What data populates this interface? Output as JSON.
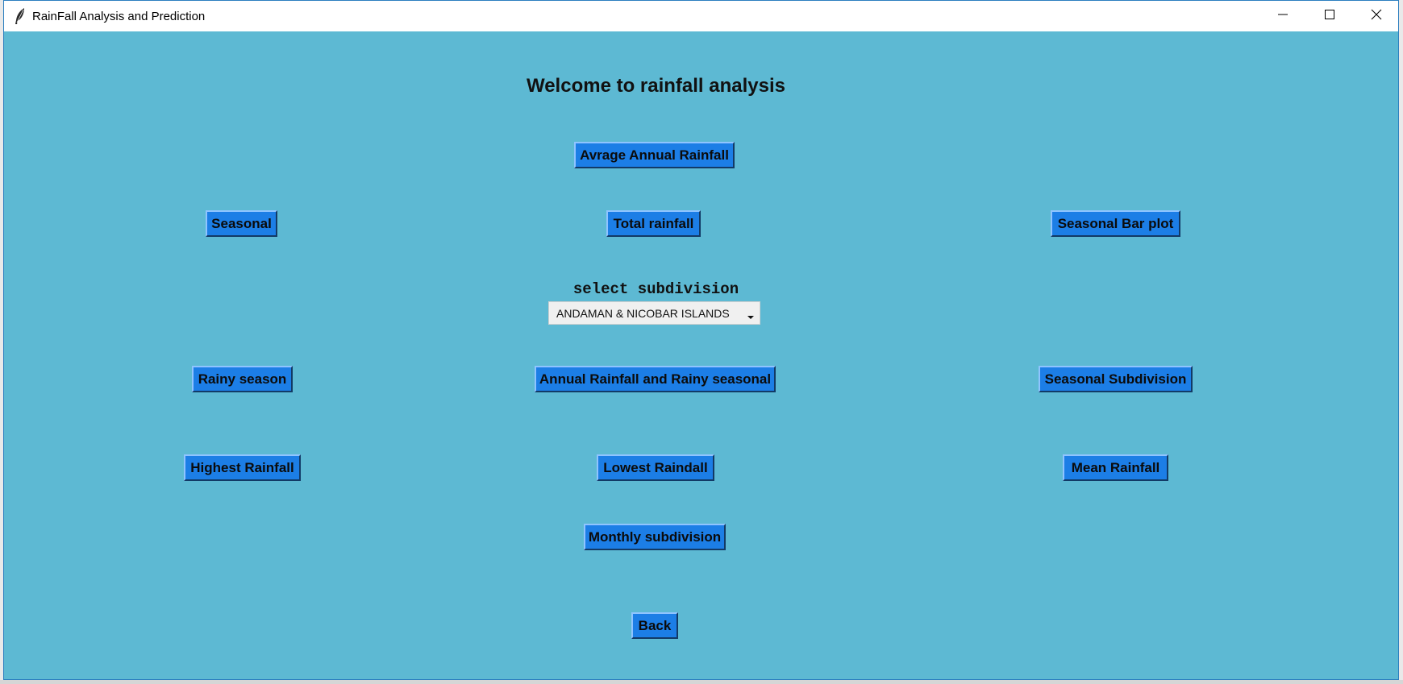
{
  "window": {
    "title": "RainFall Analysis and Prediction"
  },
  "main": {
    "heading": "Welcome to rainfall analysis",
    "select_label": "select subdivision",
    "subdivision_value": "ANDAMAN & NICOBAR ISLANDS"
  },
  "buttons": {
    "avg_annual": "Avrage Annual Rainfall",
    "seasonal": "Seasonal",
    "total_rainfall": "Total rainfall",
    "seasonal_bar_plot": "Seasonal Bar plot",
    "rainy_season": "Rainy season",
    "annual_rainy_seasonal": "Annual Rainfall and Rainy seasonal",
    "seasonal_subdivision": "Seasonal Subdivision",
    "highest_rainfall": "Highest Rainfall",
    "lowest_raindall": "Lowest Raindall",
    "mean_rainfall": "Mean Rainfall",
    "monthly_subdivision": "Monthly subdivision",
    "back": "Back"
  },
  "colors": {
    "background": "#5db9d3",
    "button": "#1c7ee6"
  }
}
